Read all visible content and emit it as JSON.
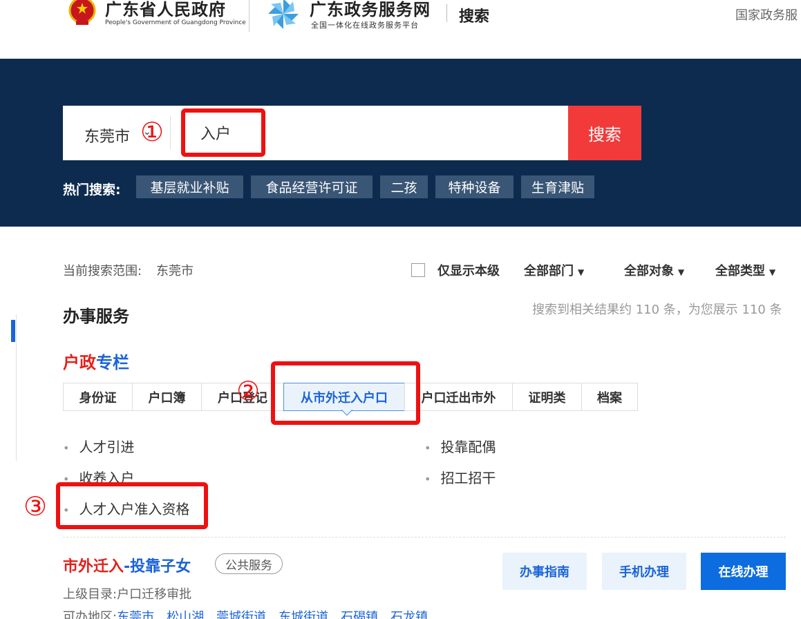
{
  "header": {
    "gov_title": "广东省人民政府",
    "gov_subtitle": "People's Government of Guangdong Province",
    "portal_title": "广东政务服务网",
    "portal_subtitle": "全国一体化在线政务服务平台",
    "page_name": "搜索",
    "right_link": "国家政务服"
  },
  "search": {
    "region": "东莞市",
    "query": "入户",
    "button": "搜索",
    "hot_label": "热门搜索:",
    "hot_tags": [
      "基层就业补贴",
      "食品经营许可证",
      "二孩",
      "特种设备",
      "生育津贴"
    ]
  },
  "filters": {
    "scope_label": "当前搜索范围:",
    "scope_value": "东莞市",
    "only_level": "仅显示本级",
    "department": "全部部门",
    "target": "全部对象",
    "type": "全部类型"
  },
  "section": {
    "title": "办事服务",
    "result_count": "搜索到相关结果约 110 条，为您展示 110 条"
  },
  "column": {
    "title_red": "户政",
    "title_blue": "专栏",
    "tabs": [
      "身份证",
      "户口簿",
      "户口登记",
      "从市外迁入户口",
      "户口迁出市外",
      "证明类",
      "档案"
    ],
    "items_left": [
      "人才引进",
      "收养入户",
      "人才入户准入资格"
    ],
    "items_right": [
      "投靠配偶",
      "招工招干"
    ]
  },
  "service": {
    "title_red": "市外迁入",
    "title_blue": "-投靠子女",
    "badge": "公共服务",
    "parent_label": "上级目录:",
    "parent_value": "户口迁移审批",
    "area_label": "可办地区:",
    "areas": [
      "东莞市",
      "松山湖",
      "莞城街道",
      "东城街道",
      "石碣镇",
      "石龙镇"
    ],
    "btn_guide": "办事指南",
    "btn_mobile": "手机办理",
    "btn_online": "在线办理"
  },
  "annotations": [
    "①",
    "②",
    "③"
  ],
  "colors": {
    "banner": "#0c2b4e",
    "search_button": "#f23a3a",
    "accent_blue": "#1a63d8",
    "accent_red": "#e3201b",
    "annotation": "#ee1111"
  },
  "icons": {
    "gov_emblem": "national-emblem-icon",
    "portal_logo": "pinwheel-logo-icon"
  }
}
